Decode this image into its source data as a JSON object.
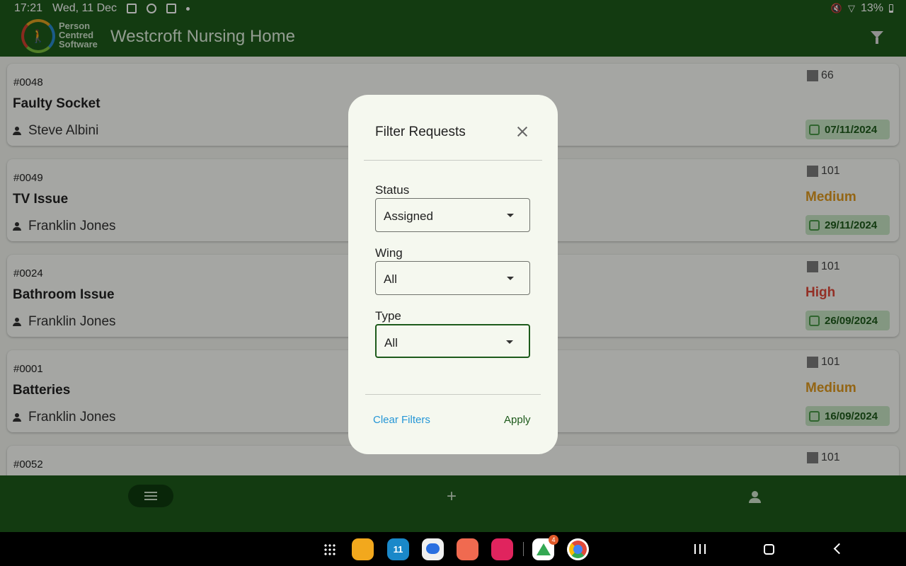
{
  "status_bar": {
    "time": "17:21",
    "date": "Wed, 11 Dec",
    "battery": "13%",
    "icons": [
      "gallery-icon",
      "drive-icon",
      "app-icon",
      "mute-icon",
      "wifi-icon",
      "battery-icon"
    ]
  },
  "app_bar": {
    "logo_text": [
      "Person",
      "Centred",
      "Software"
    ],
    "title": "Westcroft Nursing Home",
    "filter_icon": "filter-icon"
  },
  "requests": [
    {
      "number": "#0048",
      "title": "Faulty Socket",
      "person": "Steve Albini",
      "room": "66",
      "priority": "",
      "priority_color": "",
      "date": "07/11/2024"
    },
    {
      "number": "#0049",
      "title": "TV Issue",
      "person": "Franklin Jones",
      "room": "101",
      "priority": "Medium",
      "priority_color": "#e09a1f",
      "date": "29/11/2024"
    },
    {
      "number": "#0024",
      "title": "Bathroom Issue",
      "person": "Franklin Jones",
      "room": "101",
      "priority": "High",
      "priority_color": "#e04a3a",
      "date": "26/09/2024"
    },
    {
      "number": "#0001",
      "title": "Batteries",
      "person": "Franklin Jones",
      "room": "101",
      "priority": "Medium",
      "priority_color": "#e09a1f",
      "date": "16/09/2024"
    },
    {
      "number": "#0052",
      "title": "",
      "person": "",
      "room": "101",
      "priority": "",
      "priority_color": "",
      "date": ""
    }
  ],
  "bottom_nav": {
    "items": [
      "list-icon",
      "plus-icon",
      "person-icon"
    ],
    "active": "list"
  },
  "dialog": {
    "title": "Filter Requests",
    "fields": [
      {
        "label": "Status",
        "value": "Assigned"
      },
      {
        "label": "Wing",
        "value": "All"
      },
      {
        "label": "Type",
        "value": "All"
      }
    ],
    "clear_label": "Clear Filters",
    "apply_label": "Apply"
  },
  "system_nav": {
    "dock_apps": [
      "apps-grid-icon",
      "files-icon",
      "calendar-icon",
      "messages-icon",
      "contacts-icon",
      "screen-recorder-icon",
      "google-drive-icon",
      "chrome-icon"
    ],
    "calendar_day": "11",
    "drive_badge": "4"
  },
  "colors": {
    "primary": "#1d5a1b",
    "accent_blue": "#2596d6",
    "medium": "#e09a1f",
    "high": "#e04a3a",
    "date_chip": "#c7e5c4"
  }
}
